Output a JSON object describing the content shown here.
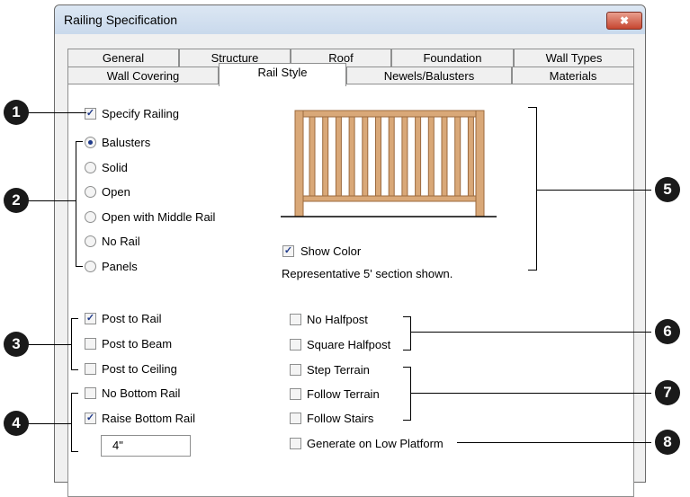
{
  "window": {
    "title": "Railing Specification",
    "close_glyph": "✖"
  },
  "tabs_row1": [
    "General",
    "Structure",
    "Roof",
    "Foundation",
    "Wall Types"
  ],
  "tabs_row2": [
    "Wall Covering",
    "Rail Style",
    "Newels/Balusters",
    "Materials"
  ],
  "active_tab": "Rail Style",
  "specify_railing": {
    "label": "Specify Railing",
    "checked": true
  },
  "rail_types": [
    {
      "label": "Balusters",
      "selected": true
    },
    {
      "label": "Solid",
      "selected": false
    },
    {
      "label": "Open",
      "selected": false
    },
    {
      "label": "Open with Middle Rail",
      "selected": false
    },
    {
      "label": "No Rail",
      "selected": false
    },
    {
      "label": "Panels",
      "selected": false
    }
  ],
  "show_color": {
    "label": "Show Color",
    "checked": true
  },
  "preview_caption": "Representative 5' section shown.",
  "post_options": [
    {
      "label": "Post to Rail",
      "checked": true
    },
    {
      "label": "Post to Beam",
      "checked": false
    },
    {
      "label": "Post to Ceiling",
      "checked": false
    }
  ],
  "bottom_rail": [
    {
      "label": "No Bottom Rail",
      "checked": false
    },
    {
      "label": "Raise Bottom Rail",
      "checked": true
    }
  ],
  "raise_value": "4\"",
  "halfpost_options": [
    {
      "label": "No Halfpost",
      "checked": false
    },
    {
      "label": "Square Halfpost",
      "checked": false
    }
  ],
  "terrain_options": [
    {
      "label": "Step Terrain",
      "checked": false
    },
    {
      "label": "Follow Terrain",
      "checked": false
    },
    {
      "label": "Follow Stairs",
      "checked": false
    }
  ],
  "low_platform": {
    "label": "Generate on Low Platform",
    "checked": false
  },
  "callouts": [
    "1",
    "2",
    "3",
    "4",
    "5",
    "6",
    "7",
    "8"
  ],
  "colors": {
    "railing": "#d9a878",
    "railing_edge": "#9c6a3e",
    "check": "#1f3a8a"
  }
}
